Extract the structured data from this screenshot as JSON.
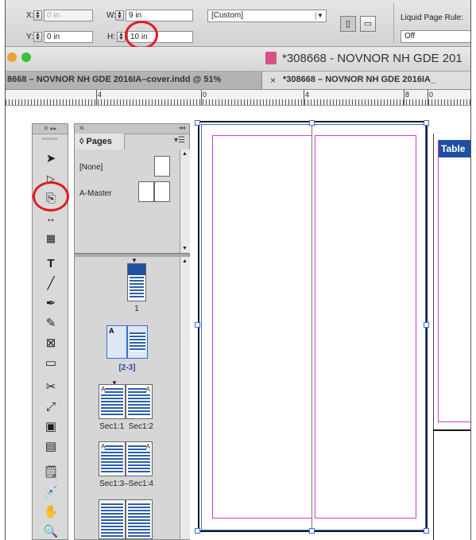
{
  "control_bar": {
    "x_label": "X:",
    "x_value": "0 in",
    "y_label": "Y:",
    "y_value": "0 in",
    "w_label": "W:",
    "w_value": "9 in",
    "h_label": "H:",
    "h_value": "10 in",
    "preset_value": "[Custom]",
    "liquid_label": "Liquid Page Rule:",
    "liquid_value": "Off"
  },
  "window": {
    "title": "*308668 - NOVNOR NH GDE 201"
  },
  "doc_tabs": [
    {
      "label": "8668 – NOVNOR NH GDE 2016IA–cover.indd @ 51%"
    },
    {
      "label": "*308668 – NOVNOR NH GDE 2016IA_"
    }
  ],
  "ruler": {
    "ticks": [
      "4",
      "0",
      "4",
      "8",
      "0"
    ]
  },
  "pages_panel": {
    "tab_label": "Pages",
    "masters": [
      {
        "label": "[None]"
      },
      {
        "label": "A-Master"
      }
    ],
    "pages": [
      {
        "caption": "1"
      },
      {
        "caption": "[2-3]"
      },
      {
        "caption": "Sec1:1  Sec1:2"
      },
      {
        "caption": "Sec1:3–Sec1:4"
      }
    ]
  },
  "canvas": {
    "right_page_label": "Table"
  },
  "icons": {
    "tools": [
      "selection-tool-icon",
      "direct-selection-tool-icon",
      "page-tool-icon",
      "gap-tool-icon",
      "content-collector-icon",
      "type-tool-icon",
      "line-tool-icon",
      "pen-tool-icon",
      "pencil-tool-icon",
      "rectangle-frame-tool-icon",
      "rectangle-tool-icon",
      "scissors-tool-icon",
      "free-transform-tool-icon",
      "gradient-swatch-tool-icon",
      "gradient-feather-tool-icon",
      "note-tool-icon",
      "eyedropper-tool-icon",
      "hand-tool-icon",
      "zoom-tool-icon"
    ]
  },
  "colors": {
    "accent_red": "#e11b22",
    "margin_magenta": "#d03ad6",
    "selection_blue": "#3a6fd1",
    "doc_blue": "#2b5fb0"
  }
}
